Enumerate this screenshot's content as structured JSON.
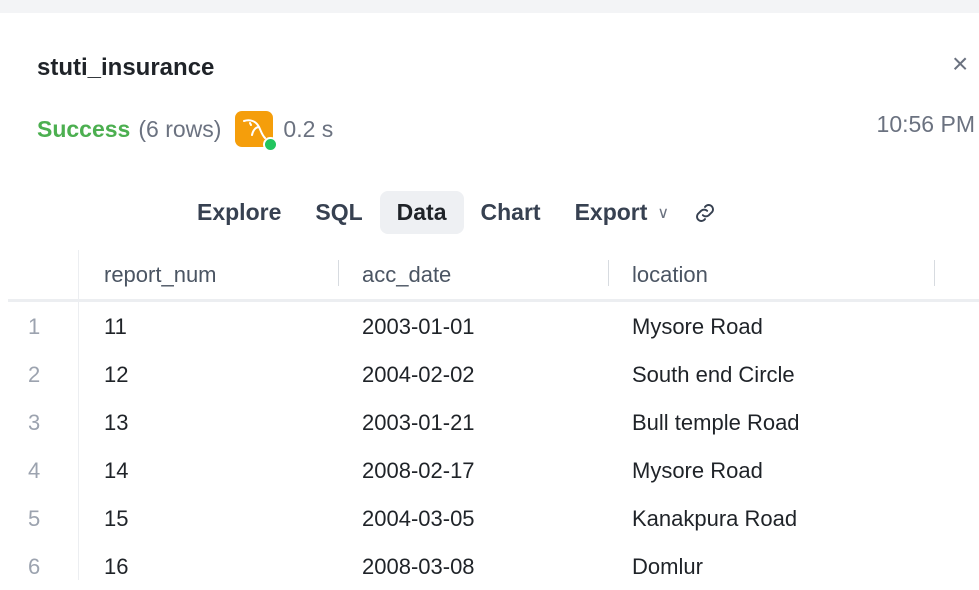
{
  "header": {
    "db_name": "stuti_insurance",
    "close_glyph": "×",
    "timestamp": "10:56 PM"
  },
  "status": {
    "state": "Success",
    "rows": "(6 rows)",
    "duration": "0.2 s",
    "db_icon": "mysql-dolphin-icon",
    "connection_status_color": "#22c55e",
    "success_color": "#4caf50",
    "icon_bg_color": "#f59e0b"
  },
  "tabs": [
    {
      "label": "Explore"
    },
    {
      "label": "SQL"
    },
    {
      "label": "Data",
      "active": true
    },
    {
      "label": "Chart"
    },
    {
      "label": "Export"
    }
  ],
  "table": {
    "columns": [
      "report_num",
      "acc_date",
      "location"
    ],
    "rows": [
      {
        "num": "1",
        "report_num": "11",
        "acc_date": "2003-01-01",
        "location": "Mysore Road"
      },
      {
        "num": "2",
        "report_num": "12",
        "acc_date": "2004-02-02",
        "location": "South end Circle"
      },
      {
        "num": "3",
        "report_num": "13",
        "acc_date": "2003-01-21",
        "location": "Bull temple Road"
      },
      {
        "num": "4",
        "report_num": "14",
        "acc_date": "2008-02-17",
        "location": "Mysore Road"
      },
      {
        "num": "5",
        "report_num": "15",
        "acc_date": "2004-03-05",
        "location": "Kanakpura Road"
      },
      {
        "num": "6",
        "report_num": "16",
        "acc_date": "2008-03-08",
        "location": "Domlur"
      }
    ]
  }
}
